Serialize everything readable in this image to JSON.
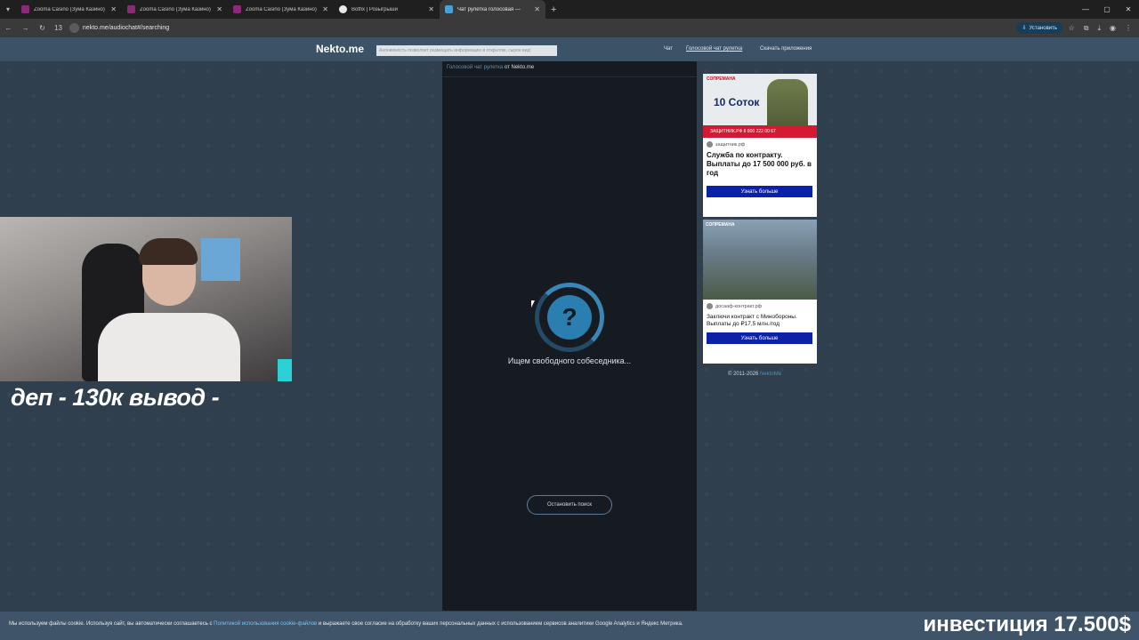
{
  "browser": {
    "tabs": [
      {
        "title": "Zooma Casino (Зума Казино) o",
        "favicon": "zooma-favicon",
        "active": false
      },
      {
        "title": "Zooma Casino (Зума Казино) o",
        "favicon": "zooma-favicon",
        "active": false
      },
      {
        "title": "Zooma Casino (Зума Казино) o",
        "favicon": "zooma-favicon",
        "active": false
      },
      {
        "title": "Botfix | Розыгрыши",
        "favicon": "botfix-favicon",
        "active": false
      },
      {
        "title": "Чат рулетка голосовая —",
        "favicon": "nekto-favicon",
        "active": true
      }
    ],
    "tab_count": "13",
    "url": "nekto.me/audiochat#/searching",
    "install_label": "Установить"
  },
  "header": {
    "logo": "Nekto.me",
    "anon_note": "Анонимность позволяет размещать информацию в открытом, сырое вид!",
    "nav": [
      "Чат",
      "Голосовой чат рулетка",
      "Скачать приложения"
    ]
  },
  "chat": {
    "head_link": "Голосовой чат рулетка",
    "head_suffix": "от Nekto.me",
    "spinner_symbol": "?",
    "status": "Ищем свободного собеседника...",
    "stop_label": "Остановить поиск"
  },
  "ads": [
    {
      "banner_tag": "СОПРЕМАНА",
      "banner_big": "10 Соток",
      "banner_strip": "ЗАЩИТНИК.РФ  8 800 222 00 67",
      "source": "защитник.рф",
      "headline": "Служба по контракту. Выплаты до 17 500 000 руб. в год",
      "cta": "Узнать больше"
    },
    {
      "banner_tag": "СОПРЕМАНА",
      "source": "досааф-контракт.рф",
      "headline": "Заключи контракт с Минобороны. Выплаты до ₽17,5 млн./год",
      "cta": "Узнать больше"
    }
  ],
  "footer": {
    "copyright": "© 2011-2026",
    "copyright_link": "NektoMe"
  },
  "stream_overlay": {
    "caption": "деп - 130к вывод -",
    "invest": "инвестиция 17.500$"
  },
  "cookie": {
    "before": "Мы используем файлы cookie. Используя сайт, вы автоматически соглашаетесь с",
    "link": "Политикой использования cookie-файлов",
    "after": "и выражаете свое согласие на обработку ваших персональных данных с использованием сервисов аналитики Google Analytics и Яндекс Метрика."
  }
}
